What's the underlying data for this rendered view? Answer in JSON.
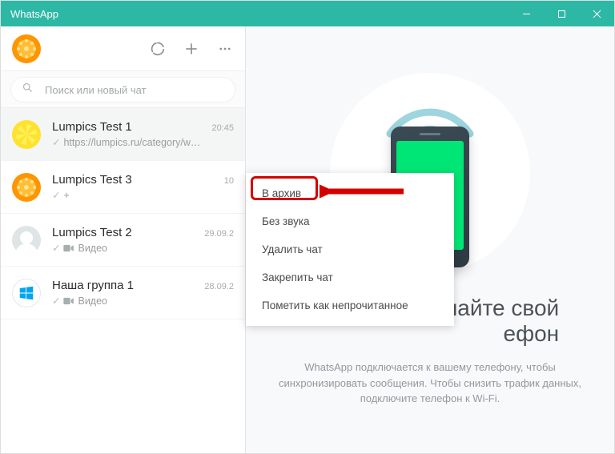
{
  "window": {
    "title": "WhatsApp"
  },
  "search": {
    "placeholder": "Поиск или новый чат"
  },
  "chats": [
    {
      "name": "Lumpics Test 1",
      "time": "20:45",
      "msg": "https://lumpics.ru/category/w…",
      "checks": true,
      "video": false,
      "avatar": "lemon"
    },
    {
      "name": "Lumpics Test 3",
      "time": "10",
      "msg": "+",
      "checks": true,
      "video": false,
      "avatar": "orange"
    },
    {
      "name": "Lumpics Test 2",
      "time": "29.09.2",
      "msg": "Видео",
      "checks": true,
      "video": true,
      "avatar": "blank"
    },
    {
      "name": "Наша группа 1",
      "time": "28.09.2",
      "msg": "Видео",
      "checks": true,
      "video": true,
      "avatar": "win"
    }
  ],
  "context_menu": {
    "items": [
      "В архив",
      "Без звука",
      "Удалить чат",
      "Закрепить чат",
      "Пометить как непрочитанное"
    ]
  },
  "intro": {
    "heading_masked": "найте свой\nефон",
    "body": "WhatsApp подключается к вашему телефону, чтобы синхронизировать сообщения. Чтобы снизить трафик данных, подключите телефон к Wi-Fi."
  }
}
